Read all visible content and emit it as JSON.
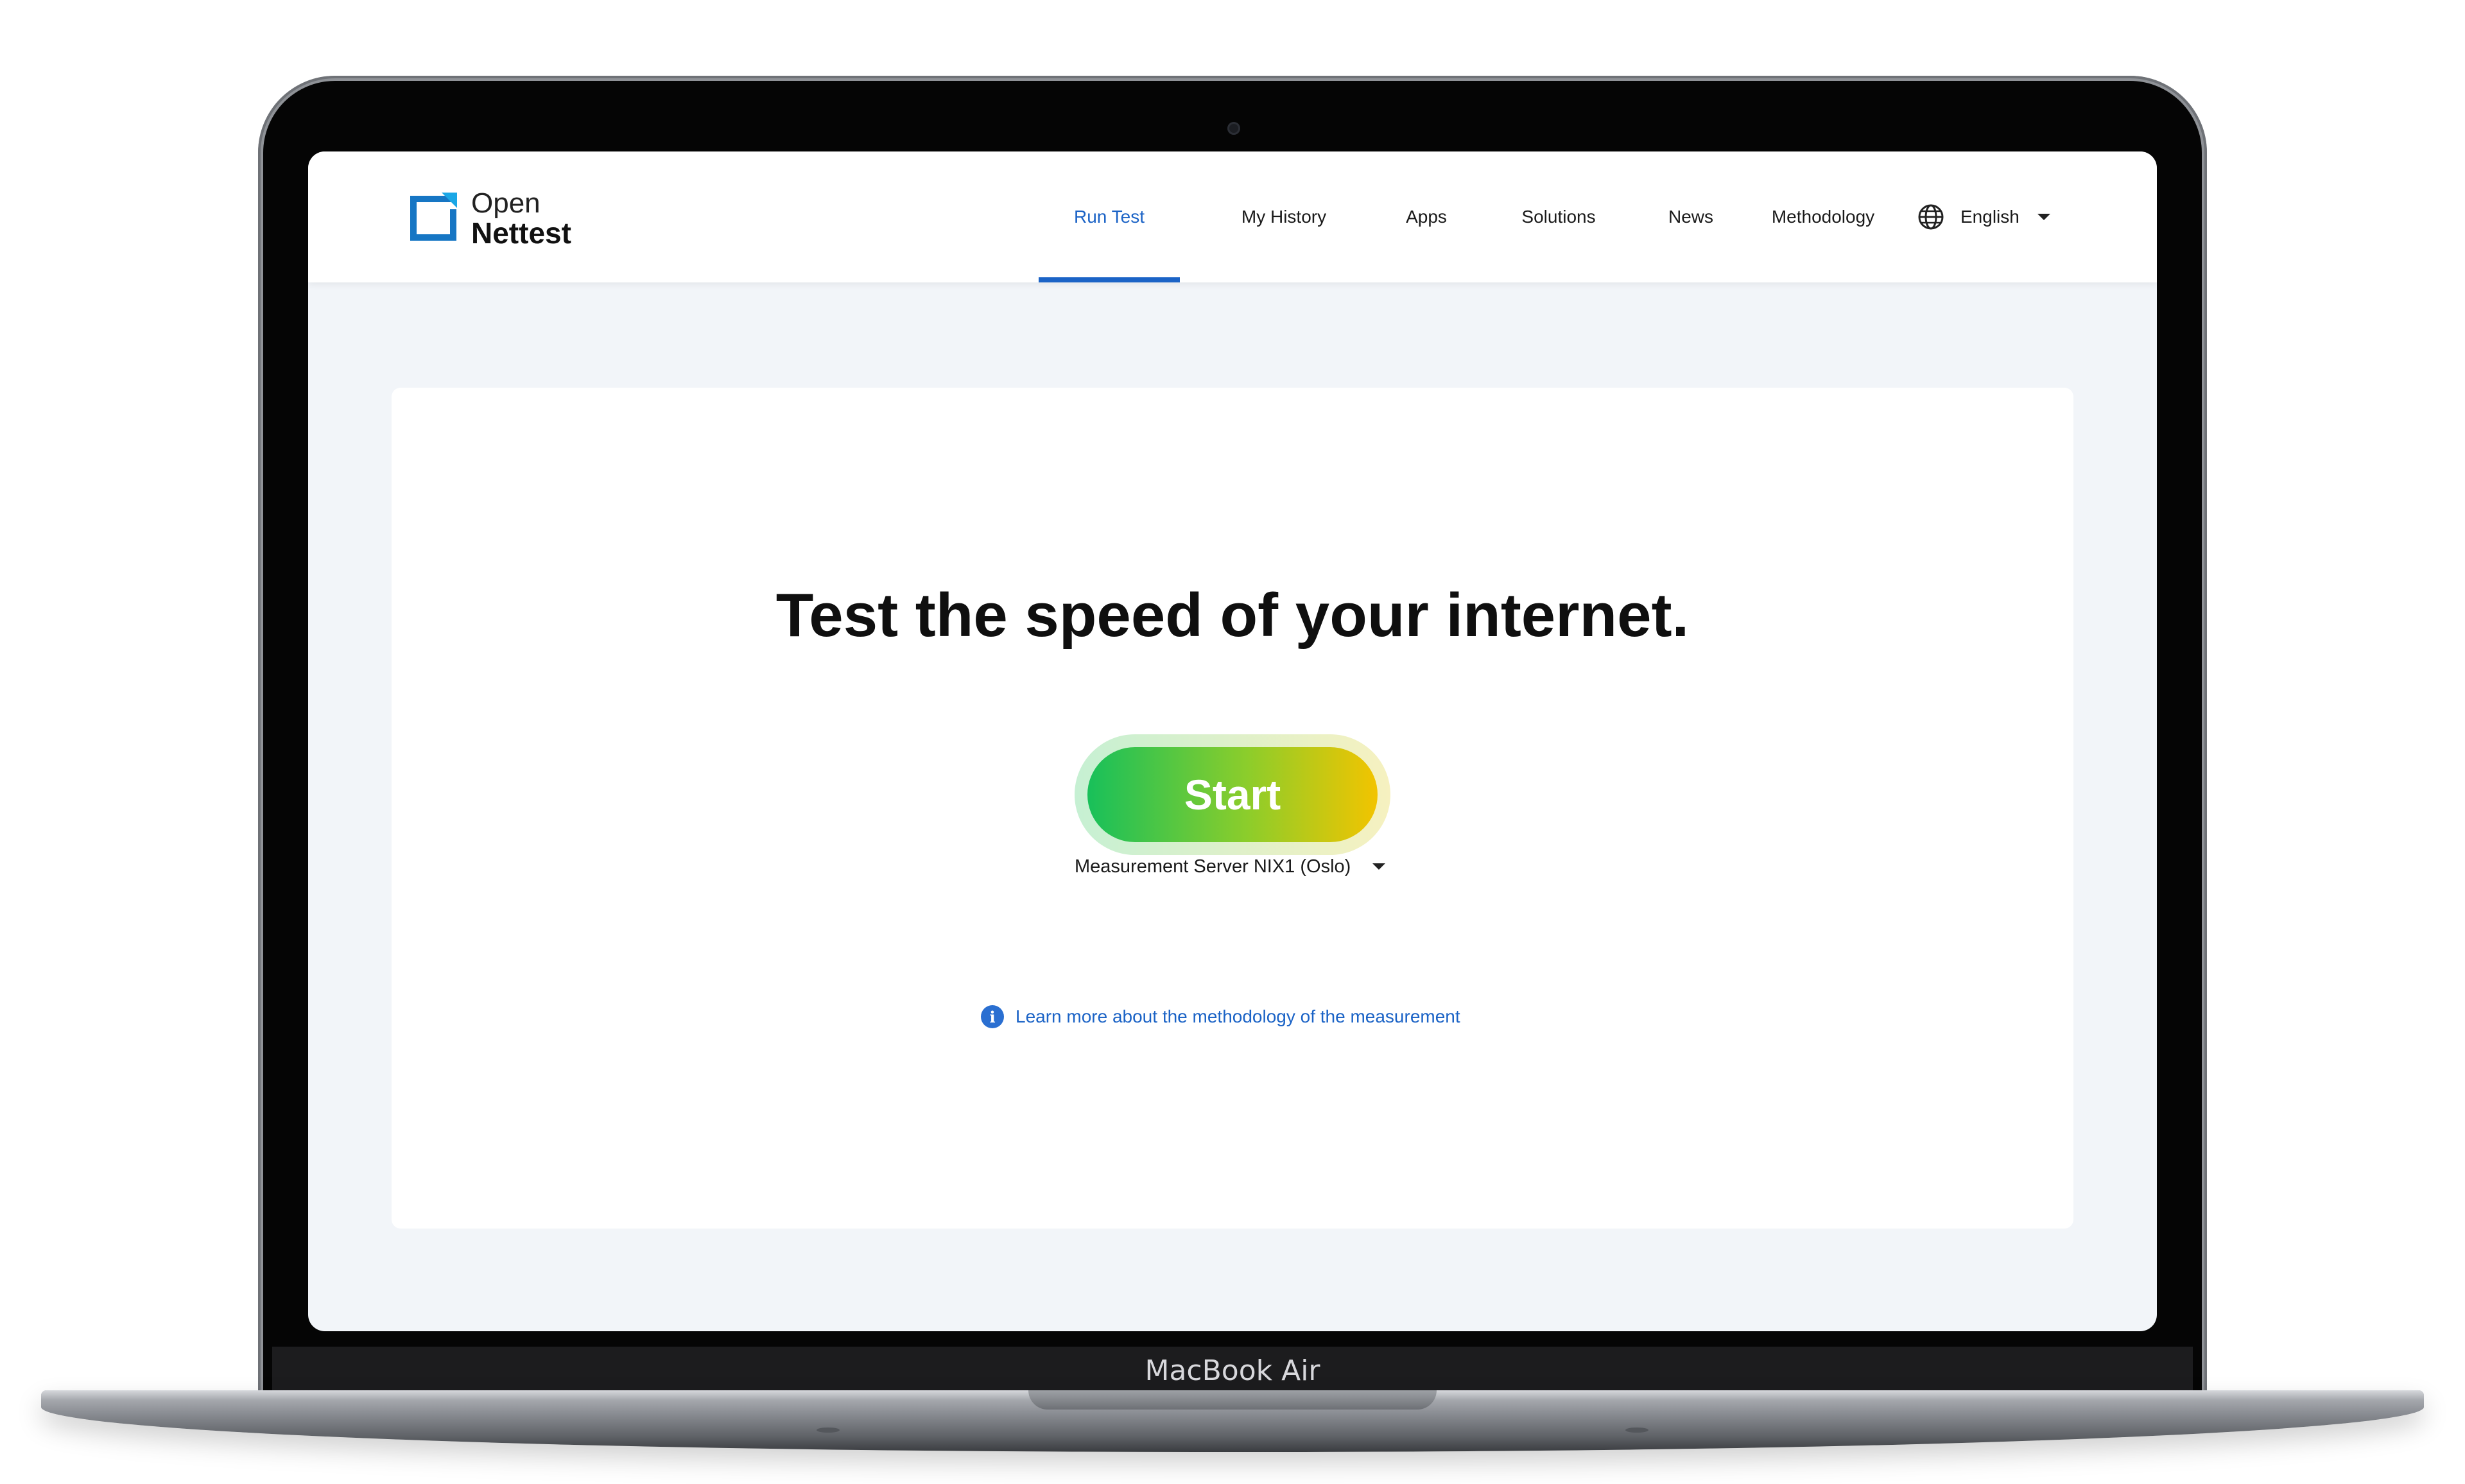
{
  "device": {
    "label": "MacBook Air"
  },
  "logo": {
    "line1": "Open",
    "line2": "Nettest",
    "color": "#1676c4"
  },
  "nav": {
    "items": [
      {
        "label": "Run Test",
        "active": true
      },
      {
        "label": "My History"
      },
      {
        "label": "Apps"
      },
      {
        "label": "Solutions"
      },
      {
        "label": "News"
      },
      {
        "label": "Methodology"
      }
    ],
    "language": "English",
    "accent_color": "#1b63c6"
  },
  "main": {
    "headline": "Test the speed of your internet.",
    "start_label": "Start",
    "server": "Measurement Server NIX1 (Oslo)",
    "methodology_link": "Learn more about the methodology of the measurement"
  },
  "icons": [
    "globe-icon",
    "chevron-down-icon",
    "info-icon",
    "camera"
  ]
}
